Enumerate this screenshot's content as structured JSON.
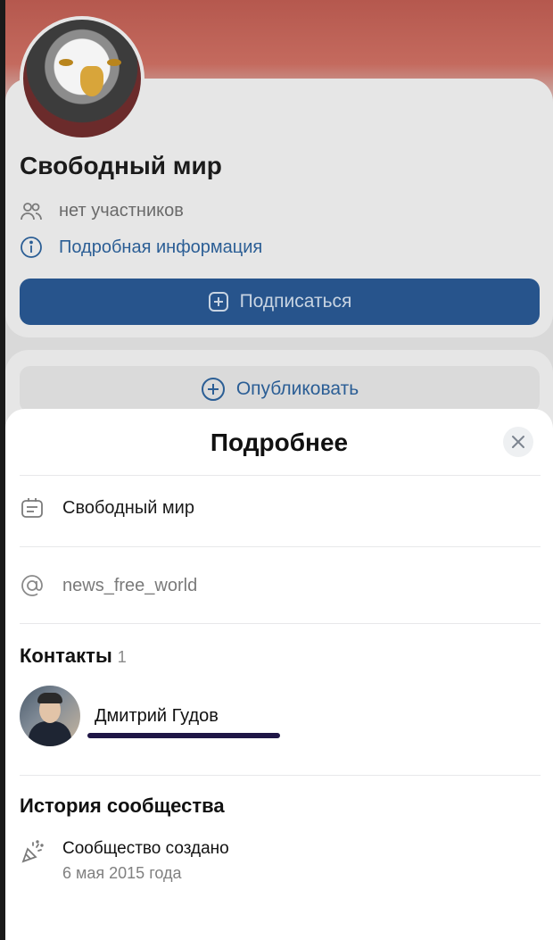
{
  "background": {
    "group_title": "Свободный мир",
    "members_text": "нет участников",
    "info_link": "Подробная информация",
    "subscribe_label": "Подписаться",
    "publish_label": "Опубликовать",
    "accent": "#2b5e95"
  },
  "sheet": {
    "title": "Подробнее",
    "name_row": "Свободный мир",
    "handle_row": "news_free_world",
    "contacts": {
      "heading": "Контакты",
      "count": "1",
      "items": [
        {
          "name": "Дмитрий Гудов"
        }
      ]
    },
    "history": {
      "heading": "История сообщества",
      "event": "Сообщество создано",
      "date": "6 мая 2015 года"
    }
  },
  "icons": {
    "members": "people-icon",
    "info": "info-icon",
    "subscribe": "plus-square-icon",
    "publish": "plus-circle-icon",
    "close": "close-icon",
    "name": "card-icon",
    "handle": "at-icon",
    "history": "party-popper-icon"
  }
}
